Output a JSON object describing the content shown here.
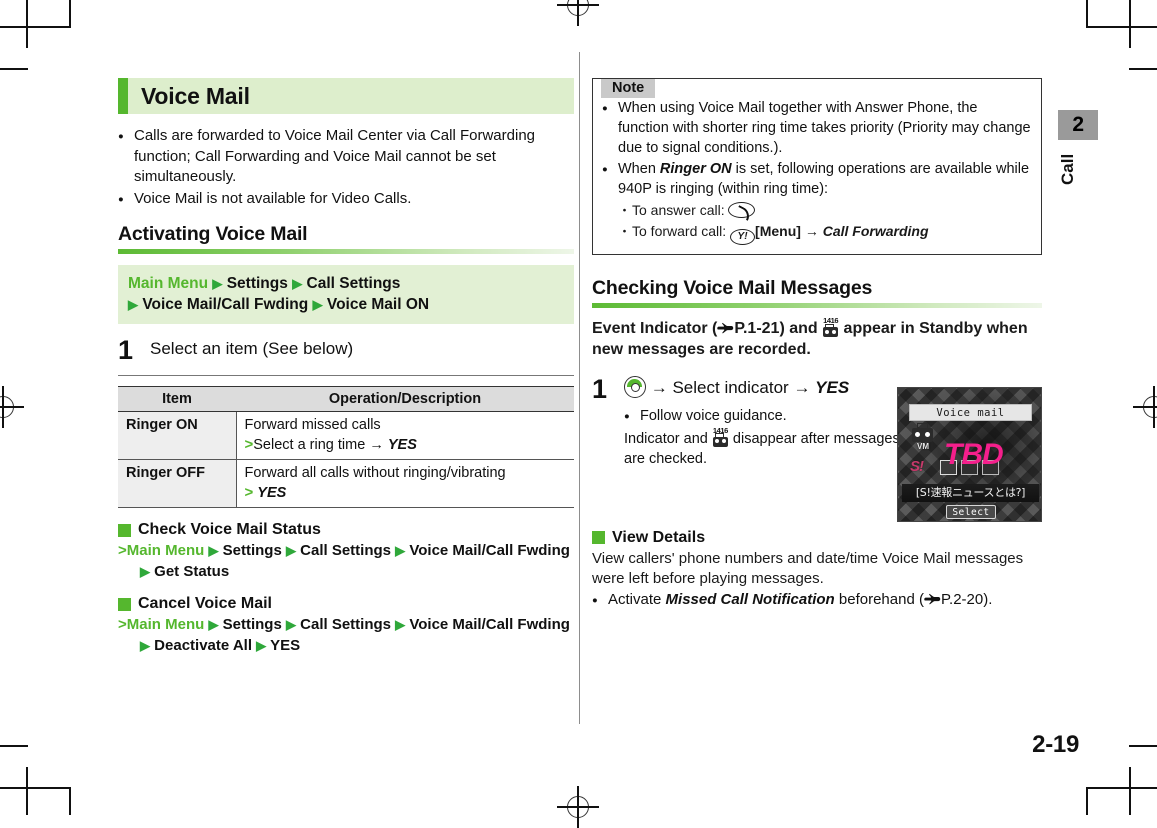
{
  "page": {
    "number": "2-19",
    "chapter_tab": {
      "number": "2",
      "label": "Call"
    }
  },
  "left_column": {
    "section_title": "Voice Mail",
    "intro_bullets": [
      "Calls are forwarded to Voice Mail Center via Call Forwarding function; Call Forwarding and Voice Mail cannot be set simultaneously.",
      "Voice Mail is not available for Video Calls."
    ],
    "subsection_title": "Activating Voice Mail",
    "nav_path": {
      "root": "Main Menu",
      "steps": [
        "Settings",
        "Call Settings",
        "Voice Mail/Call Fwding",
        "Voice Mail ON"
      ]
    },
    "step": {
      "number": "1",
      "text": "Select an item (See below)"
    },
    "table": {
      "headers": [
        "Item",
        "Operation/Description"
      ],
      "rows": [
        {
          "item": "Ringer ON",
          "line1": "Forward missed calls",
          "marker": ">",
          "line2_pre": "Select a ring time",
          "arrow": "→",
          "line2_emph": "YES"
        },
        {
          "item": "Ringer OFF",
          "line1": "Forward all calls without ringing/vibrating",
          "marker": ">",
          "line2_pre": "",
          "arrow": "",
          "line2_emph": "YES"
        }
      ]
    },
    "subheads": [
      {
        "title": "Check Voice Mail Status",
        "marker": ">",
        "root": "Main Menu",
        "steps": [
          "Settings",
          "Call Settings",
          "Voice Mail/Call Fwding"
        ],
        "steps_line2": [
          "Get Status"
        ]
      },
      {
        "title": "Cancel Voice Mail",
        "marker": ">",
        "root": "Main Menu",
        "steps": [
          "Settings",
          "Call Settings",
          "Voice Mail/Call Fwding"
        ],
        "steps_line2": [
          "Deactivate All",
          "YES"
        ]
      }
    ]
  },
  "right_column": {
    "note": {
      "tag": "Note",
      "bullet1": "When using Voice Mail together with Answer Phone, the function with shorter ring time takes priority (Priority may change due to signal conditions.).",
      "bullet2_pre": "When ",
      "bullet2_emph": "Ringer ON",
      "bullet2_post": " is set, following operations are available while 940P is ringing (within ring time):",
      "sub1_label": "To answer call:",
      "sub2_label": "To forward call:",
      "sub2_key_text": "Y!",
      "sub2_menu": "[Menu]",
      "sub2_arrow": "→",
      "sub2_emph": "Call Forwarding"
    },
    "subsection_title": "Checking Voice Mail Messages",
    "lead_pre": "Event Indicator (",
    "lead_ref": "P.1-21",
    "lead_mid": ") and ",
    "lead_post": " appear in Standby when new messages are recorded.",
    "step": {
      "number": "1",
      "arrow": "→",
      "text_mid": "Select indicator",
      "arrow2": "→",
      "emph": "YES",
      "bullet": "Follow voice guidance.",
      "note_pre": "Indicator and ",
      "note_post": " disappear after messages are checked."
    },
    "view_details": {
      "title": "View Details",
      "body": "View callers' phone numbers and date/time Voice Mail messages were left before playing messages.",
      "bullet_pre": "Activate ",
      "bullet_emph": "Missed Call Notification",
      "bullet_mid": " beforehand (",
      "bullet_ref": "P.2-20",
      "bullet_post": ")."
    },
    "phone_screen": {
      "title": "Voice mail",
      "vm_label": "VM",
      "s1_label": "S!",
      "overlay": "TBD",
      "ticker": "[S!速報ニュースとは?]",
      "softkey": "Select"
    }
  },
  "icons": {
    "indicator_number": "1416",
    "triangle": "▶"
  }
}
